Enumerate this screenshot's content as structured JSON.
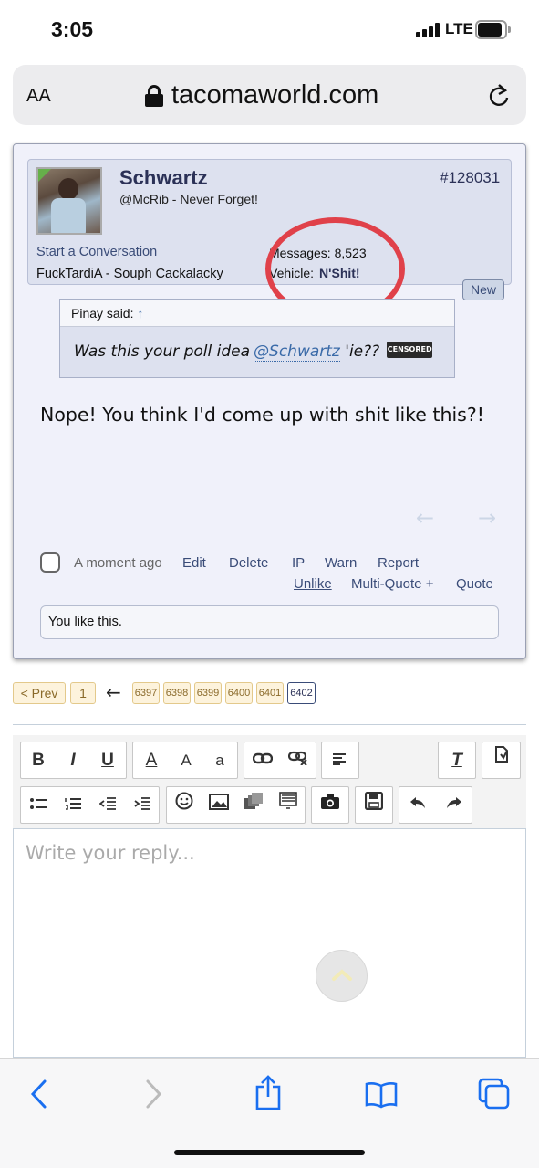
{
  "status": {
    "time": "3:05",
    "network": "LTE"
  },
  "browser": {
    "text_size": "AA",
    "domain": "tacomaworld.com"
  },
  "post": {
    "username": "Schwartz",
    "user_title": "@McRib - Never Forget!",
    "post_number": "#128031",
    "start_conversation": "Start a Conversation",
    "location": "FuckTardiA - Souph Cackalacky",
    "messages_label": "Messages:",
    "messages_value": "8,523",
    "vehicle_label": "Vehicle:",
    "vehicle_value": "N'Shit!",
    "new_badge": "New",
    "quote": {
      "author": "Pinay said:",
      "arrow": "↑",
      "text_before": "Was this your poll idea",
      "mention": "@Schwartz",
      "text_after": "'ie??",
      "censored_label": "CENSORED"
    },
    "body": "Nope! You think I'd come up with shit like this?!",
    "time_ago": "A moment ago",
    "actions": [
      "Edit",
      "Delete",
      "IP",
      "Warn",
      "Report"
    ],
    "actions2": [
      "Unlike",
      "Multi-Quote +",
      "Quote"
    ],
    "likes": "You like this."
  },
  "pagination": {
    "prev": "< Prev",
    "first": "1",
    "arrow": "←",
    "pages": [
      "6397",
      "6398",
      "6399",
      "6400",
      "6401"
    ],
    "current": "6402"
  },
  "editor": {
    "placeholder": "Write your reply...",
    "buttons": {
      "bold": "B",
      "italic": "I",
      "underline": "U",
      "color": "A",
      "size": "A",
      "font": "a",
      "clear": "T"
    }
  },
  "colors": {
    "accent": "#3a4c78",
    "circle": "#e0414a",
    "username": "#2b3157"
  }
}
